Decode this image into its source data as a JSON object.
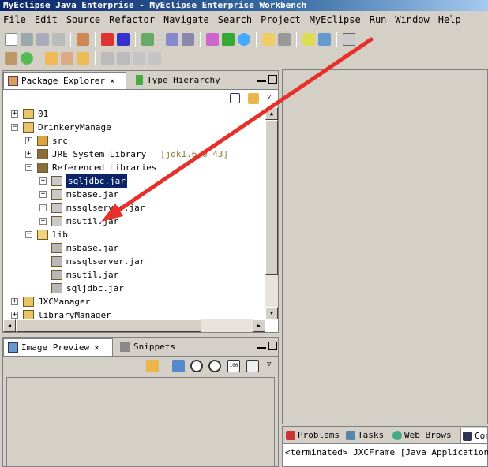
{
  "window": {
    "title": "MyEclipse Java Enterprise - MyEclipse Enterprise Workbench"
  },
  "menu": [
    "File",
    "Edit",
    "Source",
    "Refactor",
    "Navigate",
    "Search",
    "Project",
    "MyEclipse",
    "Run",
    "Window",
    "Help"
  ],
  "package_explorer": {
    "tab_label": "Package Explorer",
    "tab2_label": "Type Hierarchy",
    "tree": [
      {
        "level": 0,
        "expander": "+",
        "icon": "project-icon",
        "label": "01"
      },
      {
        "level": 0,
        "expander": "-",
        "icon": "project-icon",
        "label": "DrinkeryManage"
      },
      {
        "level": 1,
        "expander": "+",
        "icon": "source-folder-icon",
        "label": "src"
      },
      {
        "level": 1,
        "expander": "+",
        "icon": "library-icon",
        "label": "JRE System Library",
        "suffix": "[jdk1.6.0_43]"
      },
      {
        "level": 1,
        "expander": "-",
        "icon": "library-icon",
        "label": "Referenced Libraries"
      },
      {
        "level": 2,
        "expander": "+",
        "icon": "jar-icon",
        "label": "sqljdbc.jar",
        "selected": true
      },
      {
        "level": 2,
        "expander": "+",
        "icon": "jar-icon",
        "label": "msbase.jar"
      },
      {
        "level": 2,
        "expander": "+",
        "icon": "jar-icon",
        "label": "mssqlserver.jar"
      },
      {
        "level": 2,
        "expander": "+",
        "icon": "jar-icon",
        "label": "msutil.jar"
      },
      {
        "level": 1,
        "expander": "-",
        "icon": "folder-icon",
        "label": "lib"
      },
      {
        "level": 2,
        "expander": "",
        "icon": "jar-file-icon",
        "label": "msbase.jar"
      },
      {
        "level": 2,
        "expander": "",
        "icon": "jar-file-icon",
        "label": "mssqlserver.jar"
      },
      {
        "level": 2,
        "expander": "",
        "icon": "jar-file-icon",
        "label": "msutil.jar"
      },
      {
        "level": 2,
        "expander": "",
        "icon": "jar-file-icon",
        "label": "sqljdbc.jar"
      },
      {
        "level": 0,
        "expander": "+",
        "icon": "project-icon",
        "label": "JXCManager"
      },
      {
        "level": 0,
        "expander": "+",
        "icon": "project-icon",
        "label": "libraryManager"
      }
    ]
  },
  "image_preview": {
    "tab_label": "Image Preview",
    "tab2_label": "Snippets"
  },
  "bottom_tabs": [
    "Problems",
    "Tasks",
    "Web Brows",
    "Con"
  ],
  "console": {
    "status": "<terminated> JXCFrame [Java Application] C:"
  },
  "colors": {
    "selection": "#0a246a",
    "arrow": "#e8302a",
    "title_start": "#0a246a"
  }
}
